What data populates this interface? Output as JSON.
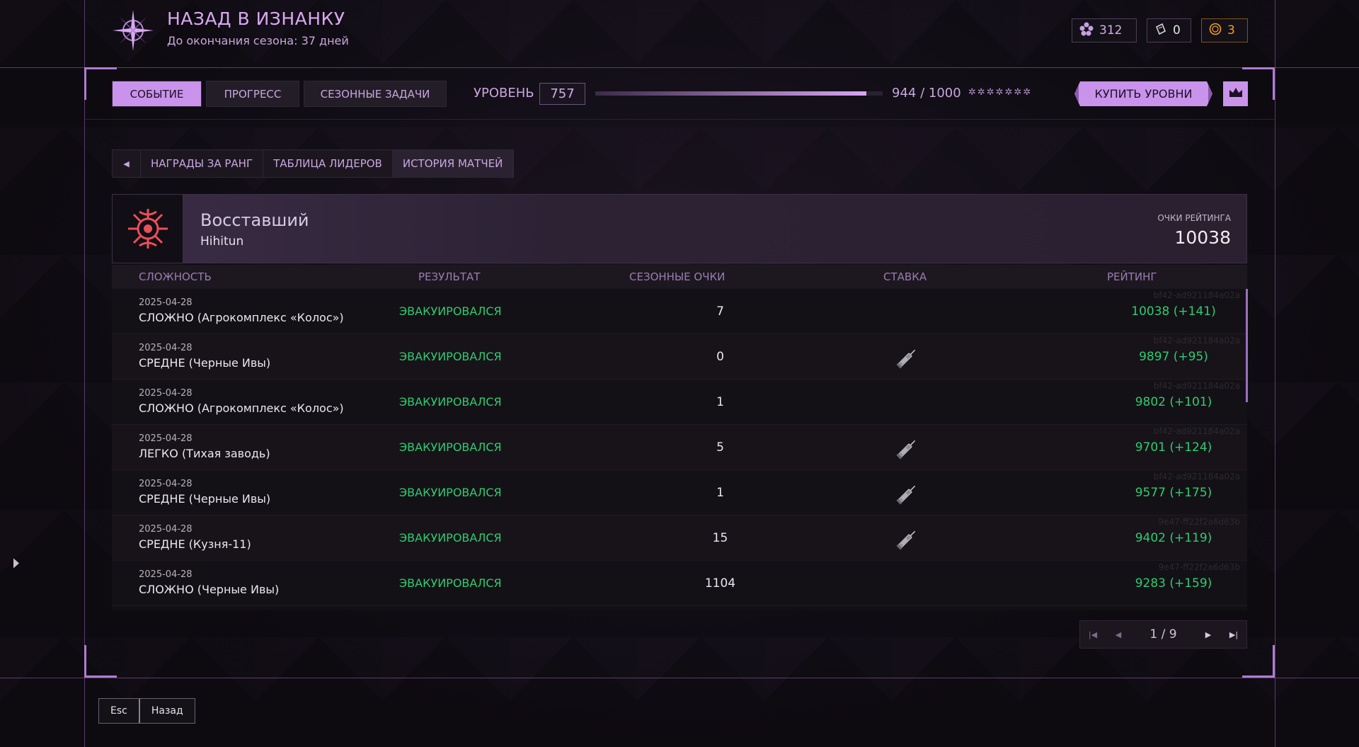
{
  "header": {
    "title": "НАЗАД В ИЗНАНКУ",
    "subtitle": "До окончания сезона: 37 дней",
    "currencies": [
      {
        "icon": "flower-icon",
        "value": "312"
      },
      {
        "icon": "ticket-icon",
        "value": "0"
      },
      {
        "icon": "coin-icon",
        "value": "3"
      }
    ]
  },
  "tabs": [
    {
      "label": "СОБЫТИЕ",
      "active": true
    },
    {
      "label": "ПРОГРЕСС",
      "active": false
    },
    {
      "label": "СЕЗОННЫЕ ЗАДАЧИ",
      "active": false
    }
  ],
  "level": {
    "label": "УРОВЕНЬ",
    "value": "757",
    "progress_text": "944 / 1000",
    "progress_fraction": 0.944,
    "stars": "✲✲✲✲✲✲✲"
  },
  "buy_button": "КУПИТЬ УРОВНИ",
  "subtabs": [
    {
      "label": "НАГРАДЫ ЗА РАНГ",
      "active": false
    },
    {
      "label": "ТАБЛИЦА ЛИДЕРОВ",
      "active": false
    },
    {
      "label": "ИСТОРИЯ МАТЧЕЙ",
      "active": true
    }
  ],
  "profile": {
    "name": "Восставший",
    "username": "Hihitun",
    "rating_label": "ОЧКИ РЕЙТИНГА",
    "rating_value": "10038"
  },
  "table": {
    "headers": [
      "СЛОЖНОСТЬ",
      "РЕЗУЛЬТАТ",
      "СЕЗОННЫЕ ОЧКИ",
      "СТАВКА",
      "РЕЙТИНГ"
    ],
    "rows": [
      {
        "date": "2025-04-28",
        "difficulty": "СЛОЖНО (Агрокомплекс «Колос»)",
        "result": "ЭВАКУИРОВАЛСЯ",
        "points": "7",
        "bet": false,
        "rating": "10038 (+141)",
        "match_id": "bf42-ad921184a02a"
      },
      {
        "date": "2025-04-28",
        "difficulty": "СРЕДНЕ (Черные Ивы)",
        "result": "ЭВАКУИРОВАЛСЯ",
        "points": "0",
        "bet": true,
        "rating": "9897 (+95)",
        "match_id": "bf42-ad921184a02a"
      },
      {
        "date": "2025-04-28",
        "difficulty": "СЛОЖНО (Агрокомплекс «Колос»)",
        "result": "ЭВАКУИРОВАЛСЯ",
        "points": "1",
        "bet": false,
        "rating": "9802 (+101)",
        "match_id": "bf42-ad921184a02a"
      },
      {
        "date": "2025-04-28",
        "difficulty": "ЛЕГКО (Тихая заводь)",
        "result": "ЭВАКУИРОВАЛСЯ",
        "points": "5",
        "bet": true,
        "rating": "9701 (+124)",
        "match_id": "bf42-ad921184a02a"
      },
      {
        "date": "2025-04-28",
        "difficulty": "СРЕДНЕ (Черные Ивы)",
        "result": "ЭВАКУИРОВАЛСЯ",
        "points": "1",
        "bet": true,
        "rating": "9577 (+175)",
        "match_id": "bf42-ad921184a02a"
      },
      {
        "date": "2025-04-28",
        "difficulty": "СРЕДНЕ (Кузня-11)",
        "result": "ЭВАКУИРОВАЛСЯ",
        "points": "15",
        "bet": true,
        "rating": "9402 (+119)",
        "match_id": "9e47-ff22f2a6d63b"
      },
      {
        "date": "2025-04-28",
        "difficulty": "СЛОЖНО (Черные Ивы)",
        "result": "ЭВАКУИРОВАЛСЯ",
        "points": "1104",
        "bet": false,
        "rating": "9283 (+159)",
        "match_id": "9e47-ff22f2a6d63b"
      }
    ]
  },
  "pagination": {
    "text": "1 / 9"
  },
  "footer": {
    "key": "Esc",
    "label": "Назад"
  },
  "colors": {
    "accent": "#c993ec",
    "success": "#2ecc71",
    "gold": "#f0a020"
  }
}
